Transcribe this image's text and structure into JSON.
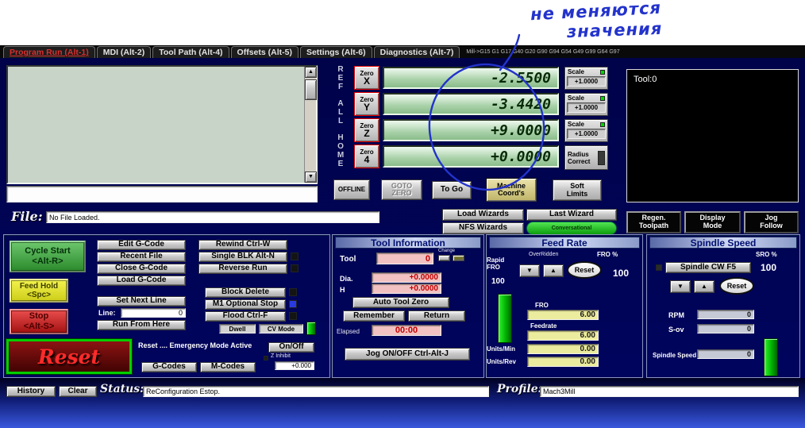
{
  "colors": {
    "annotation_blue": "#2333cc",
    "dro_green_bg": "#a8d0a8",
    "led_green": "#00d800",
    "led_blue": "#2a3ae0",
    "active_tab_red": "#d93030"
  },
  "annotation": {
    "line1": "не меняются",
    "line2": "значения"
  },
  "tab_bar": {
    "tabs": [
      {
        "label": "Program Run (Alt-1)"
      },
      {
        "label": "MDI (Alt-2)"
      },
      {
        "label": "Tool Path (Alt-4)"
      },
      {
        "label": "Offsets (Alt-5)"
      },
      {
        "label": "Settings (Alt-6)"
      },
      {
        "label": "Diagnostics (Alt-7)"
      }
    ],
    "modes_readout": "Mill->G15 G1 G17 G40 G20 G90 G94 G54 G49 G99 G64 G97"
  },
  "axis_control": {
    "ref_all_home": "R\nE\nF\n \nA\nL\nL\n \nH\nO\nM\nE",
    "zero_label": "Zero",
    "axis_x": "X",
    "axis_y": "Y",
    "axis_z": "Z",
    "axis_4": "4",
    "dro_x": "-2.5500",
    "dro_y": "-3.4420",
    "dro_z": "+9.0000",
    "dro_4": "+0.0000",
    "scale_label": "Scale",
    "scale_x": "+1.0000",
    "scale_y": "+1.0000",
    "scale_z": "+1.0000",
    "radius_correct": "Radius\nCorrect",
    "offline": "OFFLINE",
    "goto_zero": "GOTO\nZERO",
    "to_go": "To Go",
    "machine_coords": "Machine\nCoord's",
    "soft_limits": "Soft\nLimits"
  },
  "toolpath": {
    "tool_readout": "Tool:0"
  },
  "file_bar": {
    "label": "File:",
    "filename": "No File Loaded."
  },
  "wizards": {
    "load_wizards": "Load Wizards",
    "last_wizard": "Last Wizard",
    "nfs_wizards": "NFS Wizards",
    "conversational": "Conversational"
  },
  "view_controls": {
    "regen_toolpath": "Regen.\nToolpath",
    "display_mode": "Display\nMode",
    "jog_follow": "Jog\nFollow"
  },
  "run_controls": {
    "cycle_start": "Cycle Start\n<Alt-R>",
    "feed_hold": "Feed Hold\n<Spc>",
    "stop": "Stop\n<Alt-S>",
    "edit_gcode": "Edit G-Code",
    "recent_file": "Recent File",
    "close_gcode": "Close G-Code",
    "load_gcode": "Load G-Code",
    "set_next_line": "Set Next Line",
    "line_label": "Line:",
    "line_value": "0",
    "run_from_here": "Run From Here",
    "rewind": "Rewind Ctrl-W",
    "single_blk": "Single BLK Alt-N",
    "reverse_run": "Reverse Run",
    "block_delete": "Block Delete",
    "m1_optional_stop": "M1 Optional Stop",
    "flood": "Flood Ctrl-F",
    "dwell": "Dwell",
    "cv_mode": "CV Mode",
    "reset": "Reset",
    "emergency_text": "Reset .... Emergency Mode Active",
    "g_codes": "G-Codes",
    "m_codes": "M-Codes",
    "on_off": "On/Off",
    "z_inhibit_label": "Z Inhibit",
    "z_inhibit_value": "+0.000"
  },
  "tool_info": {
    "title": "Tool Information",
    "tool_label": "Tool",
    "tool_value": "0",
    "change_label": "Change",
    "dia_label": "Dia.",
    "dia_value": "+0.0000",
    "h_label": "H",
    "h_value": "+0.0000",
    "auto_tool_zero": "Auto Tool Zero",
    "remember": "Remember",
    "return": "Return",
    "elapsed_label": "Elapsed",
    "elapsed_value": "00:00",
    "jog_toggle": "Jog ON/OFF Ctrl-Alt-J"
  },
  "feed_rate": {
    "title": "Feed Rate",
    "overridden_label": "OverRidden",
    "fro_pct_label": "FRO %",
    "fro_pct_value": "100",
    "rapid_fro_label": "Rapid\nFRO",
    "rapid_fro_value": "100",
    "reset": "Reset",
    "fro_label": "FRO",
    "fro_value": "6.00",
    "feedrate_label": "Feedrate",
    "feedrate_value": "6.00",
    "units_min_label": "Units/Min",
    "units_min_value": "0.00",
    "units_rev_label": "Units/Rev",
    "units_rev_value": "0.00"
  },
  "spindle": {
    "title": "Spindle Speed",
    "sro_pct_label": "SRO %",
    "sro_pct_value": "100",
    "spindle_toggle": "Spindle CW F5",
    "reset": "Reset",
    "rpm_label": "RPM",
    "rpm_value": "0",
    "sov_label": "S-ov",
    "sov_value": "0",
    "spindle_speed_label": "Spindle Speed",
    "spindle_speed_value": "0"
  },
  "status_bar": {
    "history": "History",
    "clear": "Clear",
    "status_label": "Status:",
    "status_value": "ReConfiguration Estop.",
    "profile_label": "Profile:",
    "profile_value": "Mach3Mill"
  },
  "icons": {
    "arrow_up": "▲",
    "arrow_down": "▼"
  }
}
